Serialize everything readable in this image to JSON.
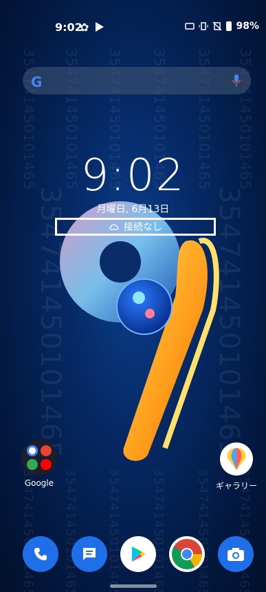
{
  "status_bar": {
    "time": "9:02",
    "battery_percent": "98%",
    "icons": [
      "gear-icon",
      "play-icon",
      "auto-icon",
      "vibrate-icon",
      "no-signal-icon",
      "battery-icon"
    ]
  },
  "search_bar": {
    "logo": "G",
    "mic_icon": "mic-icon"
  },
  "clock": {
    "time": "9:02",
    "date": "月曜日, 6月13日"
  },
  "weather": {
    "icon": "cloud-icon",
    "text": "接続なし"
  },
  "home_apps": [
    {
      "label": "Google",
      "type": "folder"
    },
    {
      "label": "ギャラリー",
      "type": "app"
    }
  ],
  "dock": [
    {
      "name": "phone",
      "color": "#1e6fe8"
    },
    {
      "name": "messages",
      "color": "#1e6fe8"
    },
    {
      "name": "play-store",
      "color": "#ffffff"
    },
    {
      "name": "chrome",
      "color": "#ffffff"
    },
    {
      "name": "camera",
      "color": "#1e6fe8"
    }
  ],
  "watermark": "354741450101465"
}
